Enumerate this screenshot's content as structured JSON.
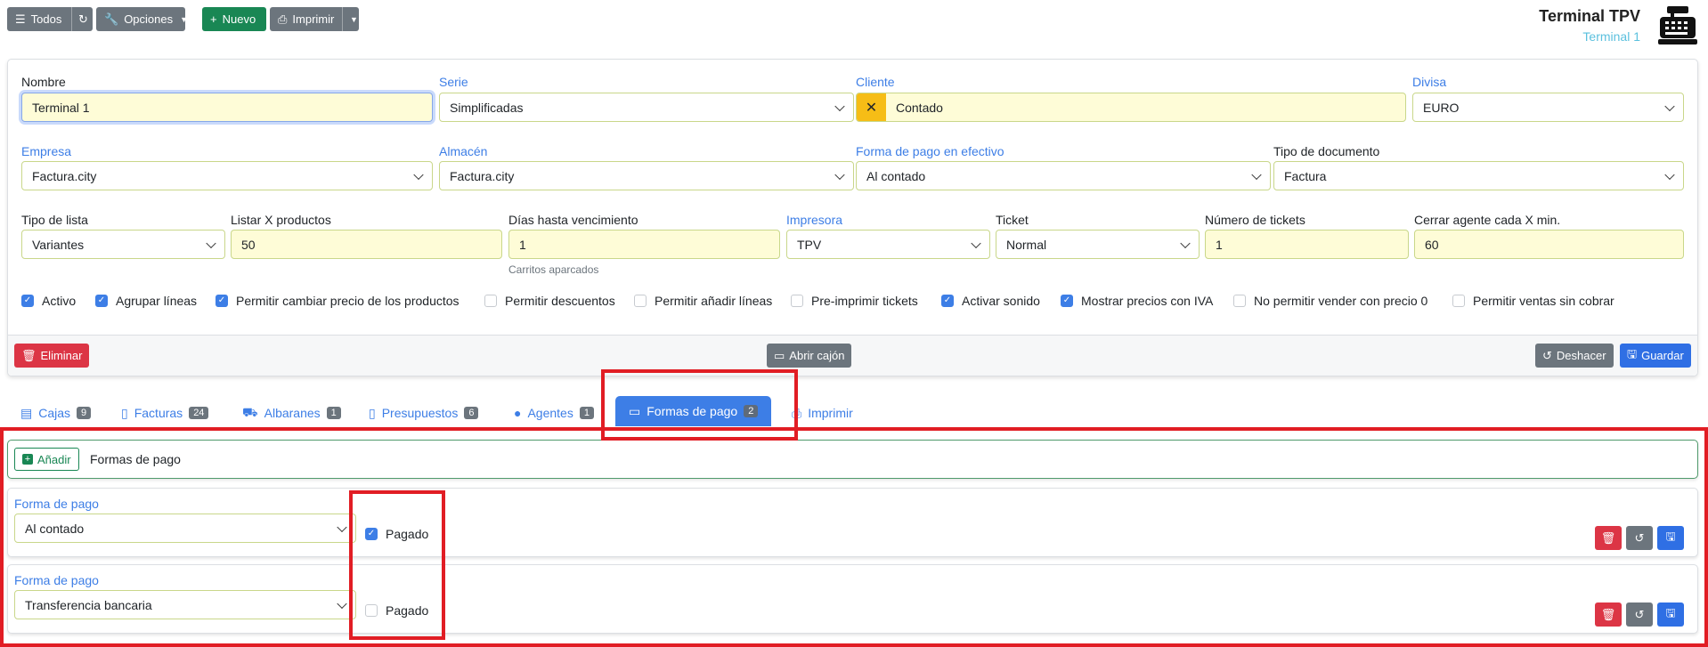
{
  "toolbar": {
    "todos": "Todos",
    "opciones": "Opciones",
    "nuevo": "Nuevo",
    "imprimir": "Imprimir"
  },
  "header": {
    "title": "Terminal TPV",
    "subtitle": "Terminal 1"
  },
  "form": {
    "nombre": {
      "label": "Nombre",
      "value": "Terminal 1"
    },
    "serie": {
      "label": "Serie",
      "value": "Simplificadas"
    },
    "cliente": {
      "label": "Cliente",
      "value": "Contado"
    },
    "divisa": {
      "label": "Divisa",
      "value": "EURO"
    },
    "empresa": {
      "label": "Empresa",
      "value": "Factura.city"
    },
    "almacen": {
      "label": "Almacén",
      "value": "Factura.city"
    },
    "forma_pago_efectivo": {
      "label": "Forma de pago en efectivo",
      "value": "Al contado"
    },
    "tipo_documento": {
      "label": "Tipo de documento",
      "value": "Factura"
    },
    "tipo_lista": {
      "label": "Tipo de lista",
      "value": "Variantes"
    },
    "listar_productos": {
      "label": "Listar X productos",
      "value": "50"
    },
    "dias_vencimiento": {
      "label": "Días hasta vencimiento",
      "value": "1",
      "hint": "Carritos aparcados"
    },
    "impresora": {
      "label": "Impresora",
      "value": "TPV"
    },
    "ticket": {
      "label": "Ticket",
      "value": "Normal"
    },
    "num_tickets": {
      "label": "Número de tickets",
      "value": "1"
    },
    "cerrar_agente": {
      "label": "Cerrar agente cada X min.",
      "value": "60"
    }
  },
  "checkboxes": [
    {
      "label": "Activo",
      "checked": true
    },
    {
      "label": "Agrupar líneas",
      "checked": true
    },
    {
      "label": "Permitir cambiar precio de los productos",
      "checked": true
    },
    {
      "label": "Permitir descuentos",
      "checked": false
    },
    {
      "label": "Permitir añadir líneas",
      "checked": false
    },
    {
      "label": "Pre-imprimir tickets",
      "checked": false
    },
    {
      "label": "Activar sonido",
      "checked": true
    },
    {
      "label": "Mostrar precios con IVA",
      "checked": true
    },
    {
      "label": "No permitir vender con precio 0",
      "checked": false
    },
    {
      "label": "Permitir ventas sin cobrar",
      "checked": false
    }
  ],
  "footer": {
    "eliminar": "Eliminar",
    "abrir_cajon": "Abrir cajón",
    "deshacer": "Deshacer",
    "guardar": "Guardar"
  },
  "tabs": [
    {
      "label": "Cajas",
      "badge": "9"
    },
    {
      "label": "Facturas",
      "badge": "24"
    },
    {
      "label": "Albaranes",
      "badge": "1"
    },
    {
      "label": "Presupuestos",
      "badge": "6"
    },
    {
      "label": "Agentes",
      "badge": "1"
    },
    {
      "label": "Formas de pago",
      "badge": "2"
    },
    {
      "label": "Imprimir",
      "badge": ""
    }
  ],
  "payments": {
    "add_label": "Añadir",
    "section_title": "Formas de pago",
    "rows": [
      {
        "label": "Forma de pago",
        "value": "Al contado",
        "paid_label": "Pagado",
        "paid": true
      },
      {
        "label": "Forma de pago",
        "value": "Transferencia bancaria",
        "paid_label": "Pagado",
        "paid": false
      }
    ]
  },
  "colors": {
    "accent": "#3d7ee6",
    "danger": "#dc3545",
    "success": "#198754",
    "highlight": "#e11d24",
    "field_yellow": "#fefcd7"
  }
}
